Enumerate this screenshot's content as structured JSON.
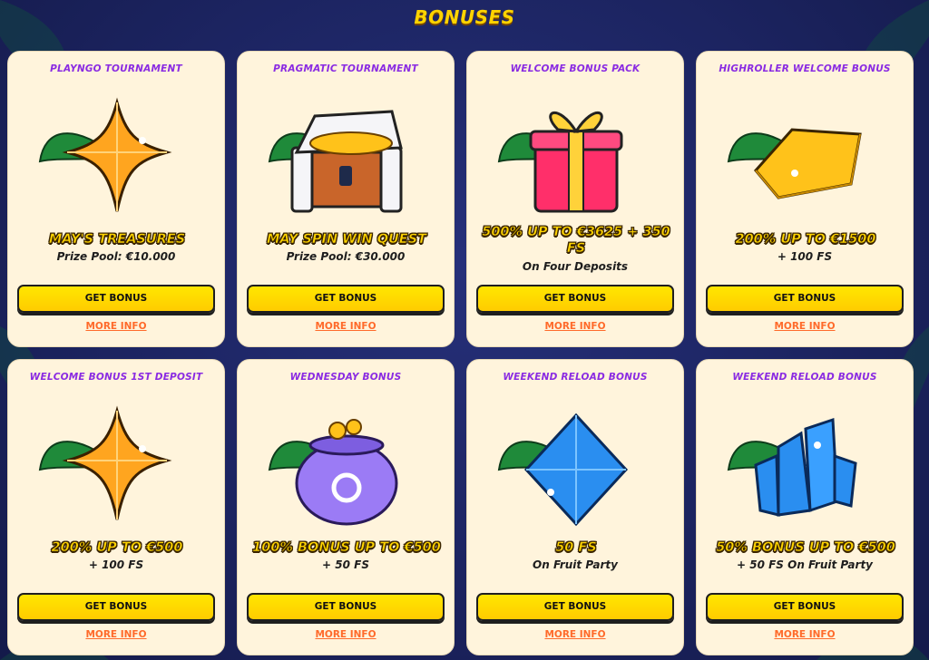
{
  "page": {
    "title": "BONUSES"
  },
  "cards": [
    {
      "title": "PLAYNGO TOURNAMENT",
      "icon": "orange-star-gem-icon",
      "headline": "MAY'S TREASURES",
      "sub1": "Prize Pool: €10.000",
      "sub2": "",
      "button": "GET BONUS",
      "more": "MORE INFO"
    },
    {
      "title": "PRAGMATIC TOURNAMENT",
      "icon": "treasure-chest-icon",
      "headline": "MAY SPIN WIN QUEST",
      "sub1": "Prize Pool: €30.000",
      "sub2": "",
      "button": "GET BONUS",
      "more": "MORE INFO"
    },
    {
      "title": "WELCOME BONUS PACK",
      "icon": "gift-box-icon",
      "headline": "500% UP TO €3625 + 350 FS",
      "sub1": "On Four Deposits",
      "sub2": "",
      "button": "GET BONUS",
      "more": "MORE INFO"
    },
    {
      "title": "HIGHROLLER WELCOME BONUS",
      "icon": "gold-bar-icon",
      "headline": "200% UP TO €1500",
      "sub1": "+ 100 FS",
      "sub2": "",
      "button": "GET BONUS",
      "more": "MORE INFO"
    },
    {
      "title": "WELCOME BONUS 1ST DEPOSIT",
      "icon": "orange-star-gem-icon",
      "headline": "200% UP TO €500",
      "sub1": "+ 100 FS",
      "sub2": "",
      "button": "GET BONUS",
      "more": "MORE INFO"
    },
    {
      "title": "WEDNESDAY BONUS",
      "icon": "purple-pot-icon",
      "headline": "100% BONUS UP TO €500",
      "sub1": "+ 50 FS",
      "sub2": "",
      "button": "GET BONUS",
      "more": "MORE INFO"
    },
    {
      "title": "WEEKEND RELOAD BONUS",
      "icon": "blue-diamond-icon",
      "headline": "50 FS",
      "sub1": "On Fruit Party",
      "sub2": "",
      "button": "GET BONUS",
      "more": "MORE INFO"
    },
    {
      "title": "WEEKEND RELOAD BONUS",
      "icon": "blue-crystals-icon",
      "headline": "50% BONUS UP TO €500",
      "sub1": "+ 50 FS On Fruit Party",
      "sub2": "",
      "button": "GET BONUS",
      "more": "MORE INFO"
    }
  ],
  "colors": {
    "background": "#1c2461",
    "card": "#fff4dc",
    "title": "#ffd400",
    "card_title": "#8a2be2",
    "button": "#ffd400",
    "link": "#ff6a2a"
  }
}
